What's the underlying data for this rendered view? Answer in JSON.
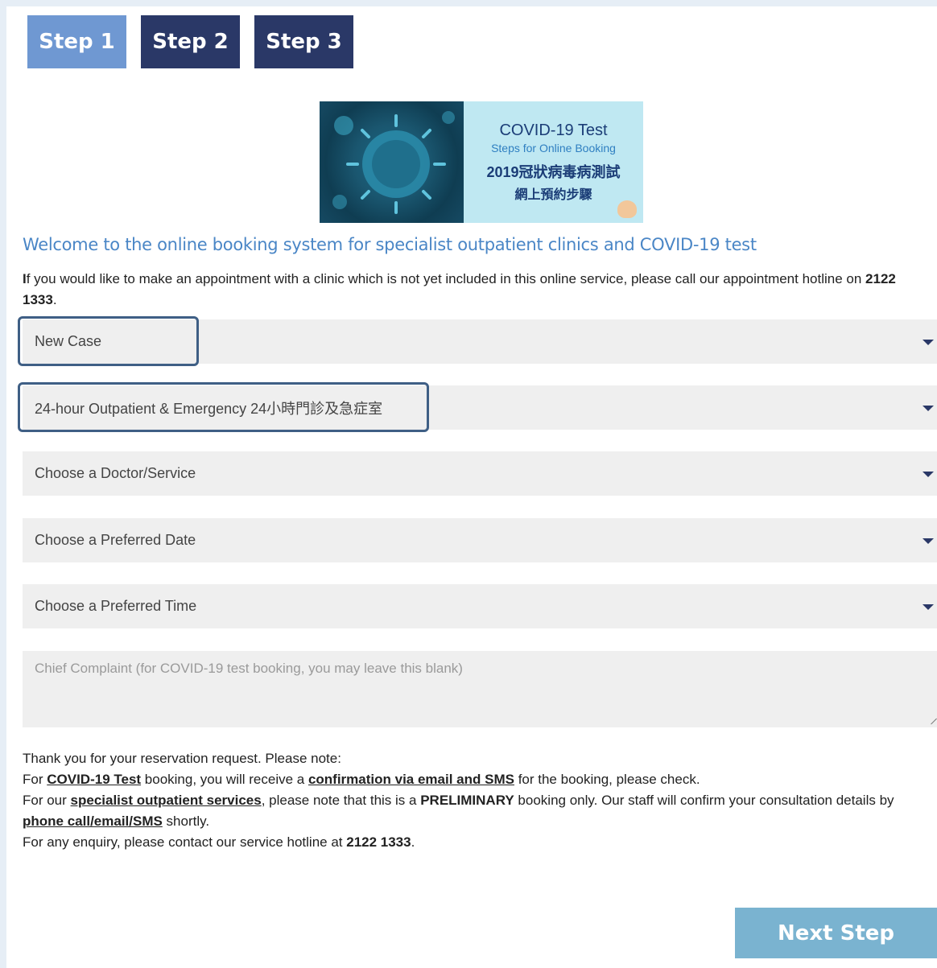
{
  "steps": [
    {
      "label": "Step 1",
      "active": true
    },
    {
      "label": "Step 2",
      "active": false
    },
    {
      "label": "Step 3",
      "active": false
    }
  ],
  "banner": {
    "title": "COVID-19 Test",
    "subtitle": "Steps for Online Booking",
    "zh_line1": "2019冠狀病毒病測試",
    "zh_line2": "網上預約步驟"
  },
  "welcome": "Welcome to the online booking system for specialist outpatient clinics and COVID-19 test",
  "intro": {
    "lead_letter": "I",
    "text": "f you would like to make an appointment with a clinic which is not yet included in this online service, please call our appointment hotline on ",
    "hotline": "2122 1333",
    "end": "."
  },
  "form": {
    "case_type": "New Case",
    "department": "24-hour Outpatient & Emergency 24小時門診及急症室",
    "doctor": "Choose a Doctor/Service",
    "date": "Choose a Preferred Date",
    "time": "Choose a Preferred Time",
    "complaint_placeholder": "Chief Complaint (for COVID-19 test booking, you may leave this blank)"
  },
  "notes": {
    "line1": "Thank you for your reservation request. Please note:",
    "line2_a": "For ",
    "line2_link1": "COVID-19 Test",
    "line2_b": " booking, you will receive a ",
    "line2_link2": "confirmation via email and SMS",
    "line2_c": " for the booking, please check.",
    "line3_a": "For our ",
    "line3_link": "specialist outpatient services",
    "line3_b": ", please note that this is a ",
    "line3_bold": "PRELIMINARY",
    "line3_c": " booking only. Our staff will confirm your consultation details by ",
    "line3_link2": "phone call/email/SMS",
    "line3_d": " shortly.",
    "line4_a": "For any enquiry, please contact our service hotline at ",
    "line4_bold": "2122 1333",
    "line4_b": "."
  },
  "next_label": "Next Step",
  "colors": {
    "step_active": "#6f98d2",
    "step_inactive": "#2a3867",
    "welcome": "#4a86c6",
    "next_button": "#7ab3d0",
    "highlight_border": "#3f5f85"
  }
}
